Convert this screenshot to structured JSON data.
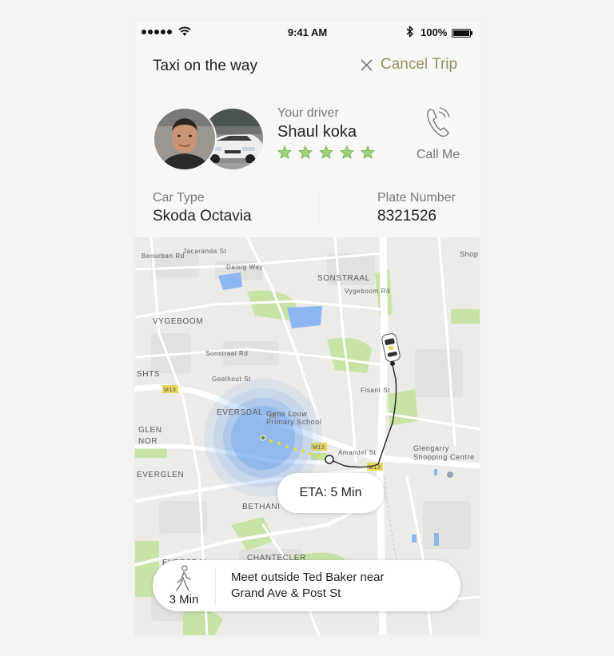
{
  "status_bar": {
    "time": "9:41 AM",
    "battery": "100%"
  },
  "header": {
    "title": "Taxi on the way",
    "cancel_label": "Cancel Trip"
  },
  "driver": {
    "label": "Your driver",
    "name": "Shaul koka",
    "rating": 5,
    "call_label": "Call Me"
  },
  "car": {
    "type_label": "Car Type",
    "type_value": "Skoda Octavia",
    "plate_label": "Plate Number",
    "plate_value": "8321526"
  },
  "map": {
    "labels": {
      "sonstraal": "SONSTRAAL",
      "vygeboom": "VYGEBOOM",
      "eversdal": "EVERSDAL",
      "eversdal2": "EVERSDAL",
      "everglen": "EVERGLEN",
      "glen": "GLEN",
      "glen_sub": "NOR",
      "bethanie": "BETHANI",
      "chantecler": "CHANTECLER",
      "shts": "SHTS",
      "gene_louw": "Gene Louw",
      "primary_school": "Primary School",
      "glengarry": "Glengarry",
      "shopping": "Shopping Centre",
      "shop": "Shop",
      "fisant": "Fisant St",
      "amandel": "Amandel St",
      "geelhout": "Geelhout St",
      "sonstraal_rd": "Sonstraal Rd",
      "daisig": "Daisig Way",
      "benurban": "Benurban Rd",
      "jacaranda": "Jacaranda St",
      "vygeboom_rd": "Vygeboom Rd",
      "m13": "M13",
      "m13b": "M13",
      "m13c": "M13"
    },
    "eta": "ETA: 5 Min",
    "pickup_walk": "3 Min",
    "pickup_text_line1": "Meet outside Ted Baker near",
    "pickup_text_line2": "Grand Ave & Post St"
  },
  "colors": {
    "accent": "#97915f",
    "star": "#9fd07a",
    "pulse": "#5b9bef",
    "park": "#c7e3a6",
    "water": "#8cb7f3"
  },
  "icons": {
    "cancel": "close-icon",
    "call": "phone-icon",
    "walk": "walking-person-icon",
    "car": "car-icon"
  }
}
